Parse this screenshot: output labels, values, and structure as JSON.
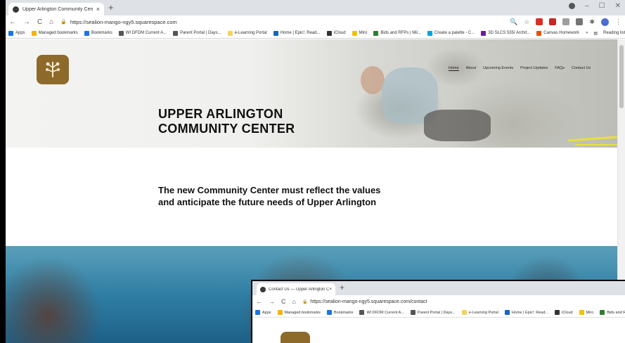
{
  "browser": {
    "tab_title": "Upper Arlington Community Cen",
    "tab_close": "×",
    "new_tab": "+",
    "url": "https://sealion-mango-ngy5.squarespace.com",
    "bookmarks": [
      {
        "label": "Apps",
        "color": "#1a73e8"
      },
      {
        "label": "Managed bookmarks",
        "color": "#f4b400"
      },
      {
        "label": "Bookmarks",
        "color": "#1a73e8"
      },
      {
        "label": "WI DFDM Current A...",
        "color": "#555555"
      },
      {
        "label": "Parent Portal | Days...",
        "color": "#555555"
      },
      {
        "label": "e-Learning Portal",
        "color": "#f4d35e"
      },
      {
        "label": "Home | Epic!: Read...",
        "color": "#1565c0"
      },
      {
        "label": "iCloud",
        "color": "#333333"
      },
      {
        "label": "Miro",
        "color": "#f2c200"
      },
      {
        "label": "Bids and RFPs | Mil...",
        "color": "#2e7d32"
      },
      {
        "label": "Create a palette - C...",
        "color": "#00a3e0"
      },
      {
        "label": "3D SLCS 535/ Archit...",
        "color": "#6a1b9a"
      },
      {
        "label": "Canvas Homework",
        "color": "#e65100"
      }
    ],
    "more": "»",
    "reading_list": "Reading list"
  },
  "site": {
    "nav": [
      "Home",
      "About",
      "Upcoming Events",
      "Project Updates",
      "FAQs",
      "Contact Us"
    ],
    "hero_title_line1": "UPPER ARLINGTON",
    "hero_title_line2": "COMMUNITY CENTER",
    "intro_line1": "The new Community Center must reflect the values",
    "intro_line2": "and anticipate the future needs of Upper Arlington",
    "logo_color": "#8e6a2a",
    "accent_yellow": "#e8e03a"
  },
  "overlay": {
    "tab_title": "Contact Us — Upper Arlington C",
    "url": "https://sealion-mango-ngy5.squarespace.com/contact",
    "bookmarks": [
      {
        "label": "Apps",
        "color": "#1a73e8"
      },
      {
        "label": "Managed bookmarks",
        "color": "#f4b400"
      },
      {
        "label": "Bookmarks",
        "color": "#1a73e8"
      },
      {
        "label": "WI DFDM Current A...",
        "color": "#555555"
      },
      {
        "label": "Parent Portal | Days...",
        "color": "#555555"
      },
      {
        "label": "e-Learning Portal",
        "color": "#f4d35e"
      },
      {
        "label": "Home | Epic!: Read...",
        "color": "#1565c0"
      },
      {
        "label": "iCloud",
        "color": "#333333"
      },
      {
        "label": "Miro",
        "color": "#f2c200"
      },
      {
        "label": "Bids and RF",
        "color": "#2e7d32"
      }
    ]
  }
}
